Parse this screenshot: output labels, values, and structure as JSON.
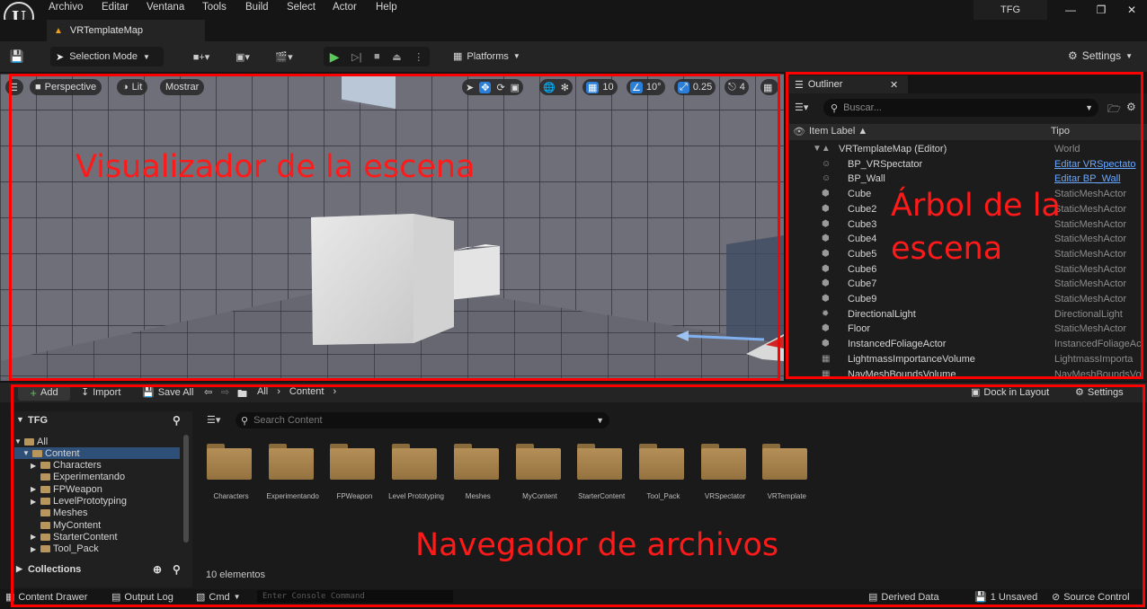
{
  "menubar": {
    "logo": "U",
    "items": [
      "Archivo",
      "Editar",
      "Ventana",
      "Tools",
      "Build",
      "Select",
      "Actor",
      "Help"
    ],
    "project": "TFG"
  },
  "tab": {
    "label": "VRTemplateMap"
  },
  "toolbar": {
    "selection_mode": "Selection Mode",
    "platforms": "Platforms",
    "settings": "Settings"
  },
  "viewport": {
    "perspective": "Perspective",
    "lit": "Lit",
    "show": "Mostrar",
    "grid_snap": "10",
    "rotation_snap": "10°",
    "scale_snap": "0.25",
    "camera_speed": "4"
  },
  "outliner": {
    "tab": "Outliner",
    "search_placeholder": "Buscar...",
    "col_label": "Item Label ▲",
    "col_type": "Tipo",
    "rows": [
      {
        "label": "VRTemplateMap (Editor)",
        "type": "World"
      },
      {
        "label": "BP_VRSpectator",
        "type": "Editar VRSpectato"
      },
      {
        "label": "BP_Wall",
        "type": "Editar BP_Wall"
      },
      {
        "label": "Cube",
        "type": "StaticMeshActor"
      },
      {
        "label": "Cube2",
        "type": "StaticMeshActor"
      },
      {
        "label": "Cube3",
        "type": "StaticMeshActor"
      },
      {
        "label": "Cube4",
        "type": "StaticMeshActor"
      },
      {
        "label": "Cube5",
        "type": "StaticMeshActor"
      },
      {
        "label": "Cube6",
        "type": "StaticMeshActor"
      },
      {
        "label": "Cube7",
        "type": "StaticMeshActor"
      },
      {
        "label": "Cube9",
        "type": "StaticMeshActor"
      },
      {
        "label": "DirectionalLight",
        "type": "DirectionalLight"
      },
      {
        "label": "Floor",
        "type": "StaticMeshActor"
      },
      {
        "label": "InstancedFoliageActor",
        "type": "InstancedFoliageAc"
      },
      {
        "label": "LightmassImportanceVolume",
        "type": "LightmassImporta"
      },
      {
        "label": "NavMeshBoundsVolume",
        "type": "NavMeshBoundsVo"
      }
    ]
  },
  "content_browser": {
    "add": "Add",
    "import": "Import",
    "save_all": "Save All",
    "path": [
      "All",
      "Content"
    ],
    "dock": "Dock in Layout",
    "settings": "Settings",
    "sources_title": "TFG",
    "tree": [
      {
        "label": "All",
        "level": 0,
        "open": true
      },
      {
        "label": "Content",
        "level": 1,
        "open": true
      },
      {
        "label": "Characters",
        "level": 2
      },
      {
        "label": "Experimentando",
        "level": 2
      },
      {
        "label": "FPWeapon",
        "level": 2
      },
      {
        "label": "LevelPrototyping",
        "level": 2
      },
      {
        "label": "Meshes",
        "level": 2
      },
      {
        "label": "MyContent",
        "level": 2
      },
      {
        "label": "StarterContent",
        "level": 2
      },
      {
        "label": "Tool_Pack",
        "level": 2
      }
    ],
    "collections": "Collections",
    "search_placeholder": "Search Content",
    "folders": [
      "Characters",
      "Experimentando",
      "FPWeapon",
      "Level Prototyping",
      "Meshes",
      "MyContent",
      "StarterContent",
      "Tool_Pack",
      "VRSpectator",
      "VRTemplate"
    ],
    "count": "10 elementos"
  },
  "statusbar": {
    "content_drawer": "Content Drawer",
    "output_log": "Output Log",
    "cmd": "Cmd",
    "console_placeholder": "Enter Console Command",
    "derived_data": "Derived Data",
    "unsaved": "1 Unsaved",
    "source_control": "Source Control"
  },
  "annotations": {
    "viewport": "Visualizador de la escena",
    "outliner_line1": "Árbol de la",
    "outliner_line2": "escena",
    "browser": "Navegador de archivos"
  },
  "colors": {
    "annotation": "#ff0000",
    "accent_blue": "#2b7fd9",
    "folder": "#b58f58",
    "play": "#5ac85a"
  }
}
